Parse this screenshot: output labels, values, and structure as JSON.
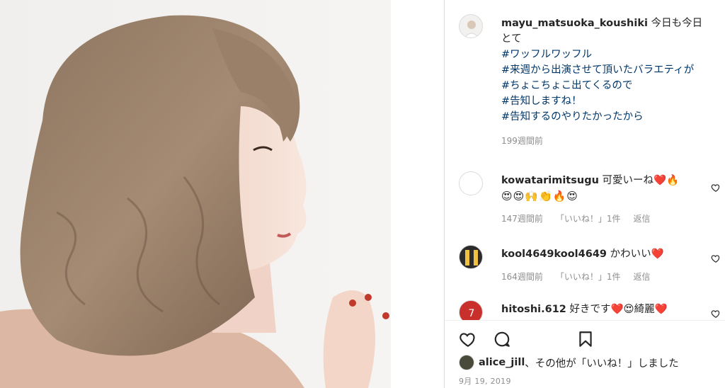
{
  "photo": {
    "description_icon": "portrait-photo"
  },
  "caption": {
    "username": "mayu_matsuoka_koushiki",
    "text": " 今日も今日とて",
    "hashtags": [
      "#ワッフルワッフル",
      "#来週から出演させて頂いたバラエティが",
      "#ちょこちょこ出てくるので",
      "#告知しますね！",
      "#告知するのやりたかったから"
    ],
    "time": "199週間前"
  },
  "comments": [
    {
      "username": "kowatarimitsugu",
      "text": " 可愛いーね❤️🔥",
      "emoji_line": "😍😍🙌👏🔥😍",
      "time": "147週間前",
      "likes": "「いいね！」1件",
      "reply": "返信"
    },
    {
      "username": "kool4649kool4649",
      "text": " かわいい❤️",
      "time": "164週間前",
      "likes": "「いいね！」1件",
      "reply": "返信"
    },
    {
      "username": "hitoshi.612",
      "text": " 好きです❤️😍綺麗❤️"
    }
  ],
  "likes_line": {
    "username": "alice_jill",
    "text": "、その他が「いいね！」しました"
  },
  "post_date": "9月 19, 2019",
  "colors": {
    "link": "#00376b",
    "muted": "#8e8e8e",
    "text": "#262626",
    "border": "#dbdbdb"
  },
  "icons": [
    "heart-icon",
    "comment-icon",
    "bookmark-icon",
    "like-comment-icon"
  ]
}
